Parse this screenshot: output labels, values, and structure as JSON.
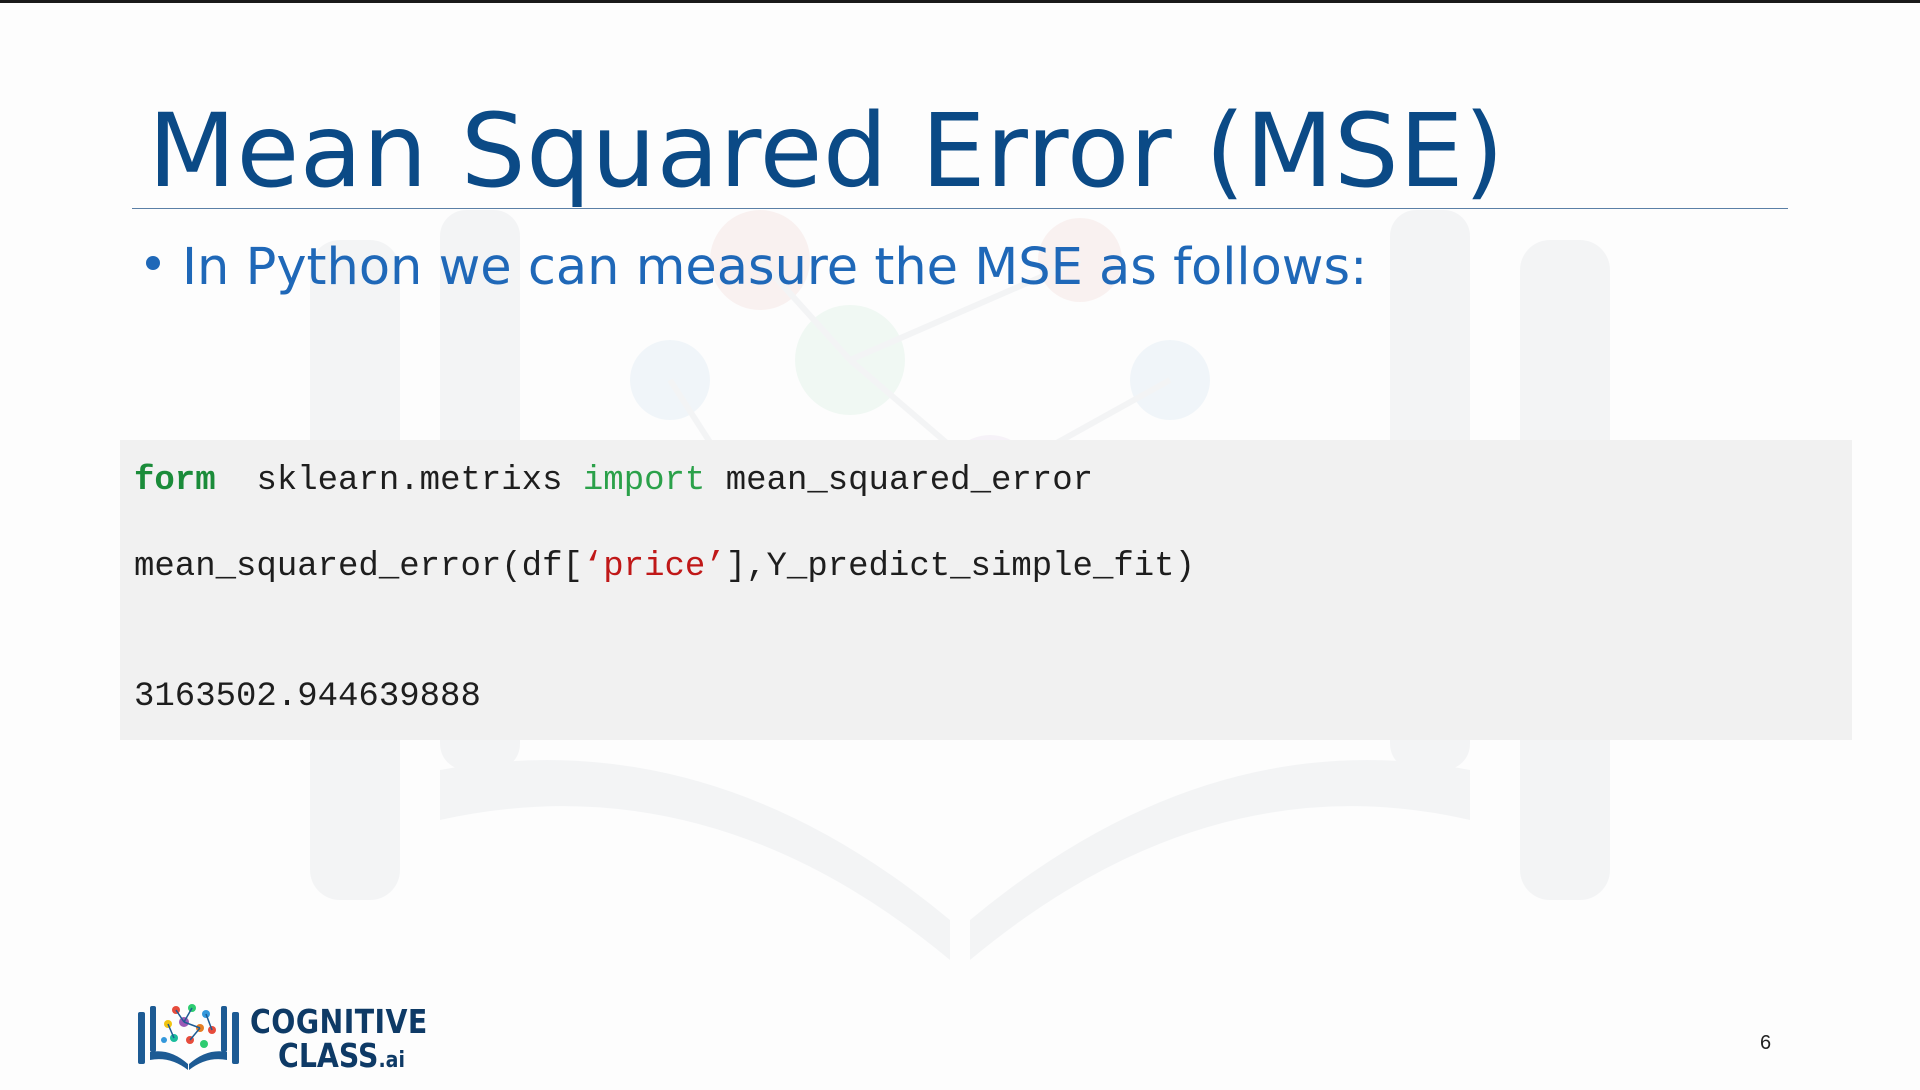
{
  "slide": {
    "title": "Mean Squared Error (MSE)",
    "bullet": "In Python we can measure the MSE as follows:",
    "code": {
      "line1": {
        "keyword_from": "form",
        "module": "sklearn.metrixs",
        "keyword_import": "import",
        "name": "mean_squared_error"
      },
      "line2": {
        "call_start": "mean_squared_error(df[",
        "string_arg": "‘price’",
        "call_end": "],Y_predict_simple_fit)"
      },
      "output": "3163502.944639888"
    },
    "logo": {
      "line1": "COGNITIVE",
      "line2": "CLASS",
      "suffix": ".ai"
    },
    "page_number": "6"
  },
  "colors": {
    "title": "#0b4a86",
    "bullet": "#1f68b8",
    "code_background": "#f1f1f1",
    "keyword": "#2ba14a",
    "string": "#c01818"
  }
}
